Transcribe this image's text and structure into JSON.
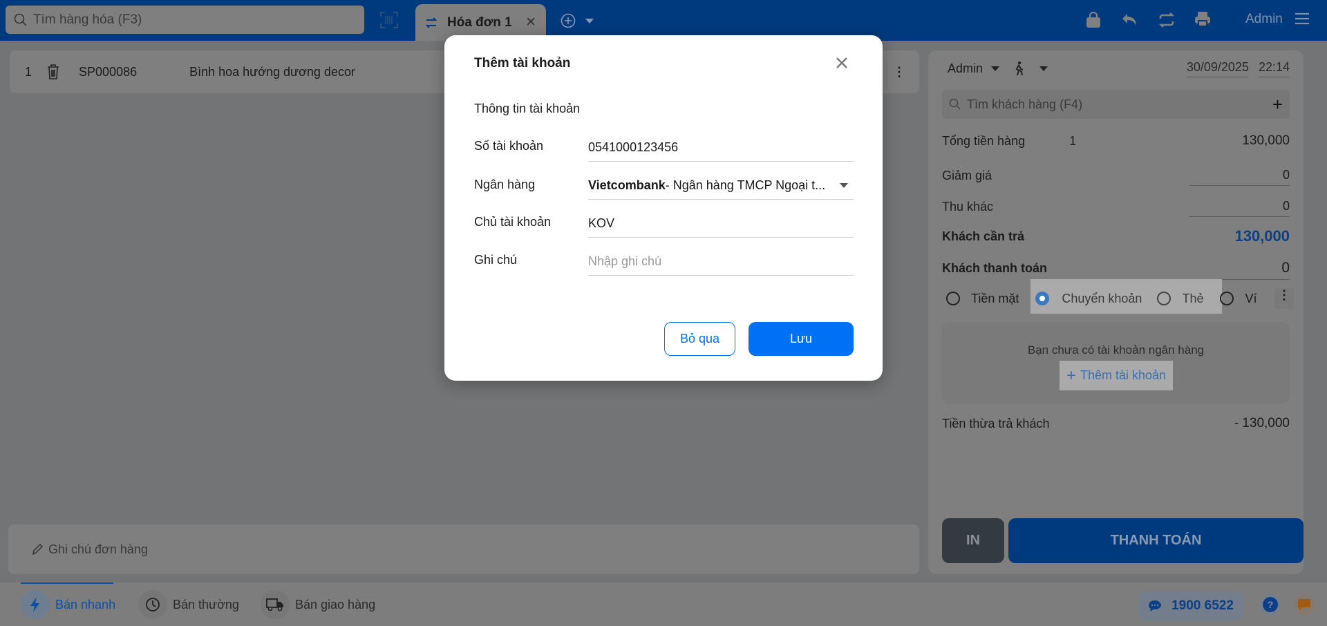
{
  "topbar": {
    "search_placeholder": "Tìm hàng hóa (F3)",
    "tab_label": "Hóa đơn 1",
    "user": "Admin"
  },
  "cart": {
    "items": [
      {
        "index": "1",
        "code": "SP000086",
        "name": "Bình hoa hướng dương decor"
      }
    ],
    "note_placeholder": "Ghi chú đơn hàng"
  },
  "bottom": {
    "modes": [
      "Bán nhanh",
      "Bán thường",
      "Bán giao hàng"
    ],
    "hotline": "1900 6522"
  },
  "right": {
    "seller": "Admin",
    "date": "30/09/2025",
    "time": "22:14",
    "customer_placeholder": "Tìm khách hàng (F4)",
    "total_label": "Tổng tiền hàng",
    "total_qty": "1",
    "total_value": "130,000",
    "discount_label": "Giảm giá",
    "discount_value": "0",
    "other_label": "Thu khác",
    "other_value": "0",
    "due_label": "Khách cần trả",
    "due_value": "130,000",
    "paid_label": "Khách thanh toán",
    "paid_value": "0",
    "methods": [
      "Tiền mặt",
      "Chuyển khoản",
      "Thẻ",
      "Ví"
    ],
    "selected_method": "Chuyển khoản",
    "no_bank": "Bạn chưa có tài khoản ngân hàng",
    "add_account": "Thêm tài khoản",
    "change_label": "Tiền thừa trả khách",
    "change_value": "- 130,000",
    "print": "IN",
    "pay": "THANH TOÁN"
  },
  "modal": {
    "title": "Thêm tài khoản",
    "section": "Thông tin tài khoản",
    "account_label": "Số tài khoản",
    "account_value": "0541000123456",
    "bank_label": "Ngân hàng",
    "bank_short": "Vietcombank",
    "bank_full": " - Ngân hàng TMCP Ngoại t...",
    "owner_label": "Chủ tài khoản",
    "owner_value": "KOV",
    "note_label": "Ghi chú",
    "note_placeholder": "Nhập ghi chú",
    "cancel": "Bỏ qua",
    "save": "Lưu"
  },
  "colors": {
    "accent": "#0070f4",
    "topbar": "#003a7e"
  }
}
